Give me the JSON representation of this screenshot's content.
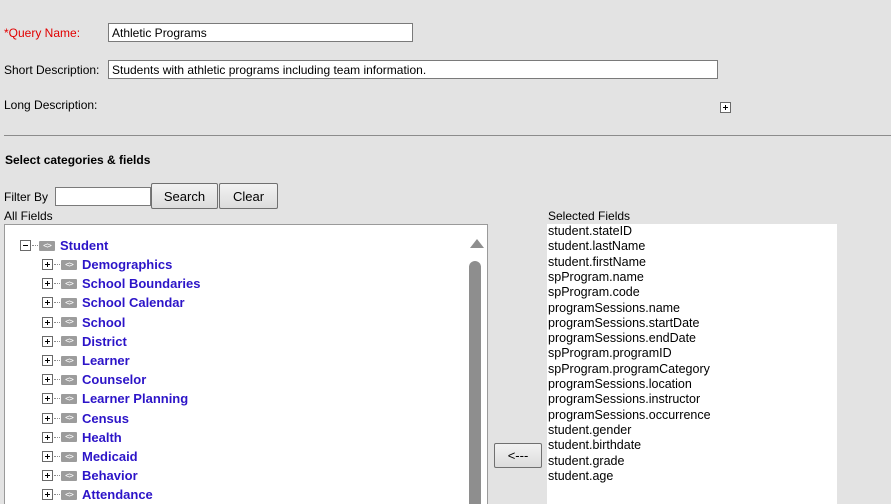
{
  "form": {
    "query_name_label": "*Query Name:",
    "query_name_value": "Athletic Programs",
    "short_desc_label": "Short Description:",
    "short_desc_value": "Students with athletic programs including team information.",
    "long_desc_label": "Long Description:"
  },
  "section": {
    "title": "Select categories & fields"
  },
  "filter": {
    "label": "Filter By",
    "value": "",
    "search_label": "Search",
    "clear_label": "Clear"
  },
  "all_fields": {
    "label": "All Fields",
    "root": "Student",
    "children": [
      "Demographics",
      "School Boundaries",
      "School Calendar",
      "School",
      "District",
      "Learner",
      "Counselor",
      "Learner Planning",
      "Census",
      "Health",
      "Medicaid",
      "Behavior",
      "Attendance"
    ],
    "node_icon_text": "<>"
  },
  "move_button": {
    "label": "<---"
  },
  "selected_fields": {
    "label": "Selected Fields",
    "items": [
      "student.stateID",
      "student.lastName",
      "student.firstName",
      "spProgram.name",
      "spProgram.code",
      "programSessions.name",
      "programSessions.startDate",
      "programSessions.endDate",
      "spProgram.programID",
      "spProgram.programCategory",
      "programSessions.location",
      "programSessions.instructor",
      "programSessions.occurrence",
      "student.gender",
      "student.birthdate",
      "student.grade",
      "student.age"
    ]
  }
}
